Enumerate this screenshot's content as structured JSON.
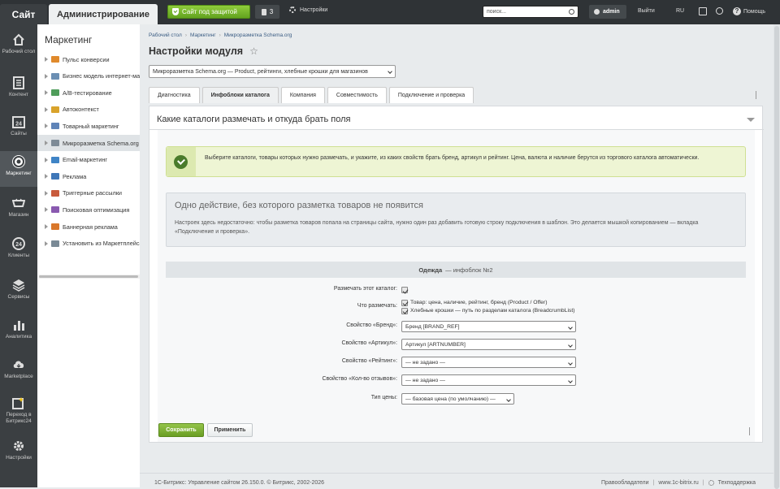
{
  "topbar": {
    "site_tab": "Сайт",
    "admin_tab": "Администрирование",
    "protect_label": "Сайт под защитой",
    "notifications_count": "3",
    "settings_label": "Настройки",
    "search_placeholder": "поиск...",
    "user_name": "admin",
    "logout_label": "Выйти",
    "lang": "RU",
    "help_label": "Помощь"
  },
  "leftbar": [
    {
      "label": "Рабочий стол",
      "icon": "home-icon"
    },
    {
      "label": "Контент",
      "icon": "content-icon"
    },
    {
      "label": "Сайты",
      "icon": "calendar-24-icon"
    },
    {
      "label": "Маркетинг",
      "icon": "target-icon"
    },
    {
      "label": "Магазин",
      "icon": "cart-icon"
    },
    {
      "label": "Клиенты",
      "icon": "clients-24-icon"
    },
    {
      "label": "Сервисы",
      "icon": "layers-icon"
    },
    {
      "label": "Аналитика",
      "icon": "bar-chart-icon"
    },
    {
      "label": "Marketplace",
      "icon": "cloud-download-icon"
    },
    {
      "label": "Переход в Битрикс24",
      "icon": "bitrix24-icon"
    },
    {
      "label": "Настройки",
      "icon": "gear-icon"
    }
  ],
  "menu": {
    "title": "Маркетинг",
    "items": [
      {
        "label": "Пульс конверсии",
        "color": "#e08a2c"
      },
      {
        "label": "Бизнес модель интернет-магазина",
        "color": "#6b8fb3"
      },
      {
        "label": "A/B-тестирование",
        "color": "#4f9d5b"
      },
      {
        "label": "Автоконтекст",
        "color": "#d9a32b"
      },
      {
        "label": "Товарный маркетинг",
        "color": "#5f84b8"
      },
      {
        "label": "Микроразметка Schema.org",
        "color": "#7d8a96"
      },
      {
        "label": "Email-маркетинг",
        "color": "#3f84c6"
      },
      {
        "label": "Реклама",
        "color": "#3f77b8"
      },
      {
        "label": "Триггерные рассылки",
        "color": "#c85a3c"
      },
      {
        "label": "Поисковая оптимизация",
        "color": "#8a5ab0"
      },
      {
        "label": "Баннерная реклама",
        "color": "#d9772b"
      },
      {
        "label": "Установить из Маркетплейса",
        "color": "#7a8a96"
      }
    ]
  },
  "breadcrumbs": [
    "Рабочий стол",
    "Маркетинг",
    "Микроразметка Schema.org"
  ],
  "page_title": "Настройки модуля",
  "module_select": "Микроразметка Schema.org — Product, рейтинги, хлебные крошки для магазинов",
  "tabs": [
    "Диагностика",
    "Инфоблоки каталога",
    "Компания",
    "Совместимость",
    "Подключение и проверка"
  ],
  "section": {
    "title": "Какие каталоги размечать и откуда брать поля",
    "ok_note": "Выберите каталоги, товары которых нужно размечать, и укажите, из каких свойств брать бренд, артикул и рейтинг. Цена, валюта и наличие берутся из торгового каталога автоматически.",
    "info_title": "Одно действие, без которого разметка товаров не появится",
    "info_text": "Настроек здесь недостаточно: чтобы разметка товаров попала на страницы сайта, нужно один раз добавить готовую строку подключения в шаблон. Это делается мышкой копированием — вкладка «Подключение и проверка».",
    "catalog_name": "Одежда",
    "catalog_suffix": "— инфоблок №2"
  },
  "form": {
    "mark_label": "Размечать этот каталог:",
    "what_label": "Что размечать:",
    "what_opt1": "Товар: цена, наличие, рейтинг, бренд (Product / Offer)",
    "what_opt2": "Хлебные крошки — путь по разделам каталога (BreadcrumbList)",
    "brand_label": "Свойство «Бренд»:",
    "brand_value": "Бренд [BRAND_REF]",
    "article_label": "Свойство «Артикул»:",
    "article_value": "Артикул [ARTNUMBER]",
    "rating_label": "Свойство «Рейтинг»:",
    "rating_value": "— не задано —",
    "reviews_label": "Свойство «Кол-во отзывов»:",
    "reviews_value": "— не задано —",
    "price_label": "Тип цены:",
    "price_value": "— базовая цена (по умолчанию) —"
  },
  "buttons": {
    "save": "Сохранить",
    "apply": "Применить"
  },
  "footer": {
    "copyright": "1С-Битрикс: Управление сайтом 26.150.0. © Битрикс, 2002-2026",
    "owners": "Правообладатели",
    "site": "www.1c-bitrix.ru",
    "support": "Техподдержка"
  },
  "colors": {
    "accent_green": "#6a9e24",
    "topbar": "#2f3336",
    "leftbar": "#3b3f42"
  }
}
